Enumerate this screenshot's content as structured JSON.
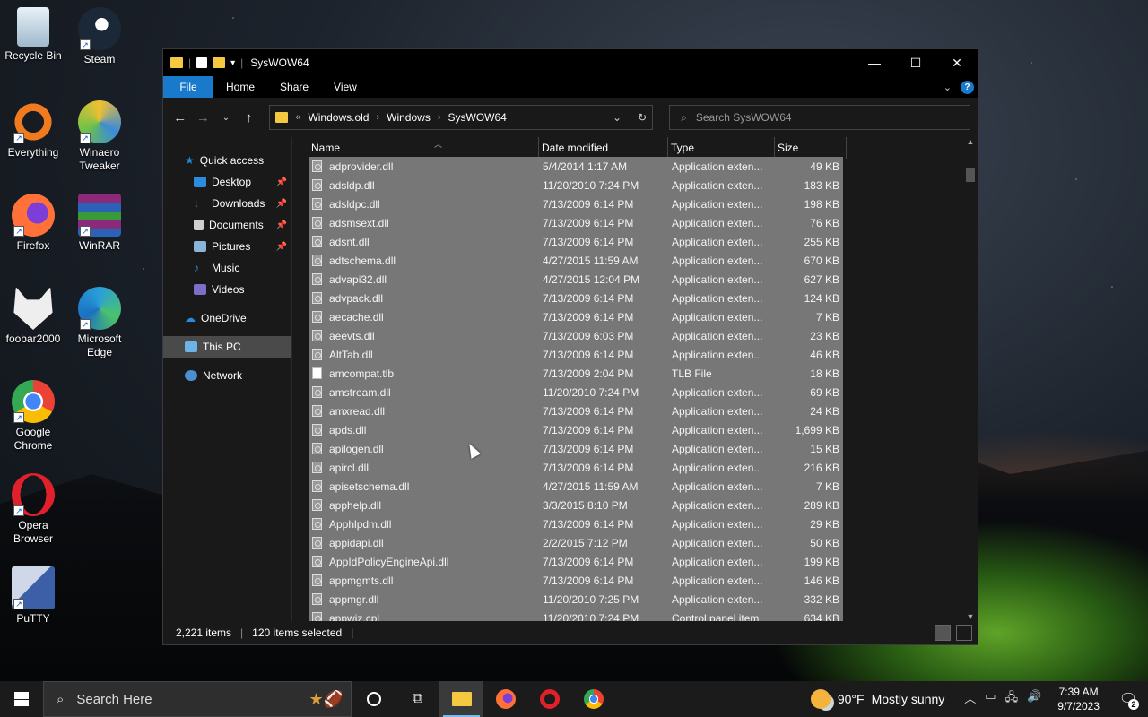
{
  "desktop": {
    "icons": [
      {
        "label": "Recycle Bin",
        "color": "#cfe3f3"
      },
      {
        "label": "Steam",
        "color": "#1b2838"
      },
      {
        "label": "Everything",
        "color": "#f07a1e"
      },
      {
        "label": "Winaero Tweaker",
        "color": "#3b8ad9"
      },
      {
        "label": "Firefox",
        "color": "#ff7139"
      },
      {
        "label": "WinRAR",
        "color": "#8b2a7a"
      },
      {
        "label": "foobar2000",
        "color": "#222222"
      },
      {
        "label": "Microsoft Edge",
        "color": "#2a9fd8"
      },
      {
        "label": "Google Chrome",
        "color": "#4285f4"
      },
      {
        "label": "Opera Browser",
        "color": "#e0202a"
      },
      {
        "label": "PuTTY",
        "color": "#3c5fa8"
      }
    ]
  },
  "window": {
    "title": "SysWOW64",
    "controls": {
      "minimize": "—",
      "maximize": "☐",
      "close": "✕"
    },
    "ribbon": {
      "file": "File",
      "home": "Home",
      "share": "Share",
      "view": "View",
      "help": "?"
    },
    "address": {
      "prefix": "«",
      "crumbs": [
        "Windows.old",
        "Windows",
        "SysWOW64"
      ]
    },
    "search_placeholder": "Search SysWOW64",
    "nav": {
      "quick_access": "Quick access",
      "desktop": "Desktop",
      "downloads": "Downloads",
      "documents": "Documents",
      "pictures": "Pictures",
      "music": "Music",
      "videos": "Videos",
      "onedrive": "OneDrive",
      "this_pc": "This PC",
      "network": "Network"
    },
    "columns": {
      "name": "Name",
      "date": "Date modified",
      "type": "Type",
      "size": "Size"
    },
    "files": [
      {
        "name": "adprovider.dll",
        "date": "5/4/2014 1:17 AM",
        "type": "Application exten...",
        "size": "49 KB",
        "icon": "dll"
      },
      {
        "name": "adsldp.dll",
        "date": "11/20/2010 7:24 PM",
        "type": "Application exten...",
        "size": "183 KB",
        "icon": "dll"
      },
      {
        "name": "adsldpc.dll",
        "date": "7/13/2009 6:14 PM",
        "type": "Application exten...",
        "size": "198 KB",
        "icon": "dll"
      },
      {
        "name": "adsmsext.dll",
        "date": "7/13/2009 6:14 PM",
        "type": "Application exten...",
        "size": "76 KB",
        "icon": "dll"
      },
      {
        "name": "adsnt.dll",
        "date": "7/13/2009 6:14 PM",
        "type": "Application exten...",
        "size": "255 KB",
        "icon": "dll"
      },
      {
        "name": "adtschema.dll",
        "date": "4/27/2015 11:59 AM",
        "type": "Application exten...",
        "size": "670 KB",
        "icon": "dll"
      },
      {
        "name": "advapi32.dll",
        "date": "4/27/2015 12:04 PM",
        "type": "Application exten...",
        "size": "627 KB",
        "icon": "dll"
      },
      {
        "name": "advpack.dll",
        "date": "7/13/2009 6:14 PM",
        "type": "Application exten...",
        "size": "124 KB",
        "icon": "dll"
      },
      {
        "name": "aecache.dll",
        "date": "7/13/2009 6:14 PM",
        "type": "Application exten...",
        "size": "7 KB",
        "icon": "dll"
      },
      {
        "name": "aeevts.dll",
        "date": "7/13/2009 6:03 PM",
        "type": "Application exten...",
        "size": "23 KB",
        "icon": "dll"
      },
      {
        "name": "AltTab.dll",
        "date": "7/13/2009 6:14 PM",
        "type": "Application exten...",
        "size": "46 KB",
        "icon": "dll"
      },
      {
        "name": "amcompat.tlb",
        "date": "7/13/2009 2:04 PM",
        "type": "TLB File",
        "size": "18 KB",
        "icon": "plain"
      },
      {
        "name": "amstream.dll",
        "date": "11/20/2010 7:24 PM",
        "type": "Application exten...",
        "size": "69 KB",
        "icon": "dll"
      },
      {
        "name": "amxread.dll",
        "date": "7/13/2009 6:14 PM",
        "type": "Application exten...",
        "size": "24 KB",
        "icon": "dll"
      },
      {
        "name": "apds.dll",
        "date": "7/13/2009 6:14 PM",
        "type": "Application exten...",
        "size": "1,699 KB",
        "icon": "dll"
      },
      {
        "name": "apilogen.dll",
        "date": "7/13/2009 6:14 PM",
        "type": "Application exten...",
        "size": "15 KB",
        "icon": "dll"
      },
      {
        "name": "apircl.dll",
        "date": "7/13/2009 6:14 PM",
        "type": "Application exten...",
        "size": "216 KB",
        "icon": "dll"
      },
      {
        "name": "apisetschema.dll",
        "date": "4/27/2015 11:59 AM",
        "type": "Application exten...",
        "size": "7 KB",
        "icon": "dll"
      },
      {
        "name": "apphelp.dll",
        "date": "3/3/2015 8:10 PM",
        "type": "Application exten...",
        "size": "289 KB",
        "icon": "dll"
      },
      {
        "name": "Apphlpdm.dll",
        "date": "7/13/2009 6:14 PM",
        "type": "Application exten...",
        "size": "29 KB",
        "icon": "dll"
      },
      {
        "name": "appidapi.dll",
        "date": "2/2/2015 7:12 PM",
        "type": "Application exten...",
        "size": "50 KB",
        "icon": "dll"
      },
      {
        "name": "AppIdPolicyEngineApi.dll",
        "date": "7/13/2009 6:14 PM",
        "type": "Application exten...",
        "size": "199 KB",
        "icon": "dll"
      },
      {
        "name": "appmgmts.dll",
        "date": "7/13/2009 6:14 PM",
        "type": "Application exten...",
        "size": "146 KB",
        "icon": "dll"
      },
      {
        "name": "appmgr.dll",
        "date": "11/20/2010 7:25 PM",
        "type": "Application exten...",
        "size": "332 KB",
        "icon": "dll"
      },
      {
        "name": "appwiz.cpl",
        "date": "11/20/2010 7:24 PM",
        "type": "Control panel item",
        "size": "634 KB",
        "icon": "dll"
      }
    ],
    "status": {
      "items": "2,221 items",
      "selected": "120 items selected"
    }
  },
  "taskbar": {
    "search_placeholder": "Search Here",
    "weather": {
      "temp": "90°F",
      "condition": "Mostly sunny"
    },
    "time": "7:39 AM",
    "date": "9/7/2023",
    "notifications": "2"
  }
}
